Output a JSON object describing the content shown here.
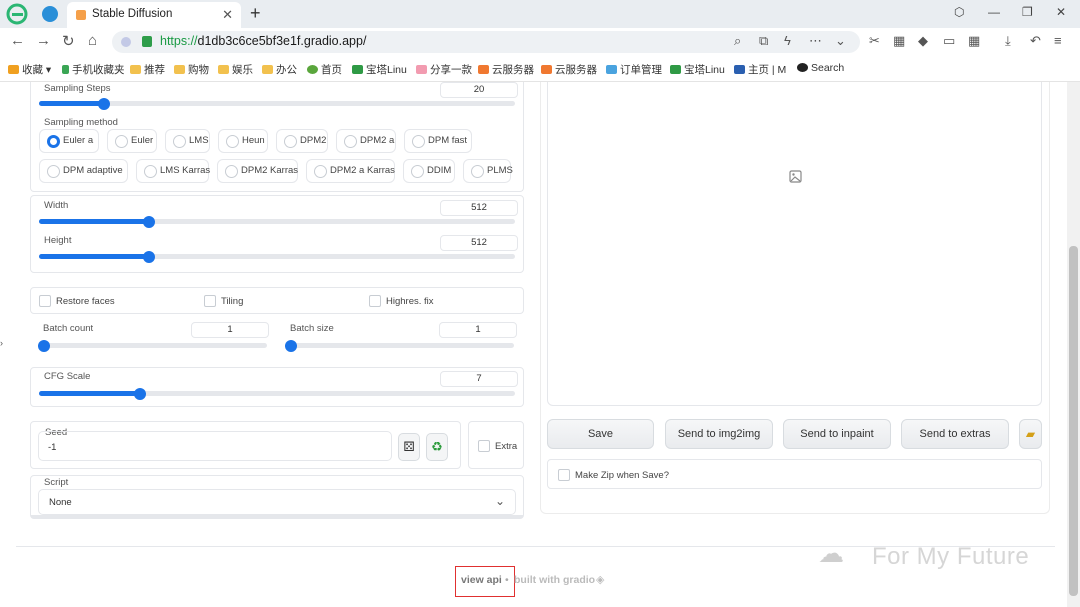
{
  "browser": {
    "tab_title": "Stable Diffusion",
    "url_host": "https://",
    "url_rest": "d1db3c6ce5bf3e1f.gradio.app/"
  },
  "bookmarks": [
    "收藏",
    "手机收藏夹",
    "推荐",
    "购物",
    "娱乐",
    "办公",
    "首页",
    "宝塔Linu",
    "分享一款",
    "云服务器",
    "云服务器",
    "订单管理",
    "宝塔Linu",
    "主页 | M",
    "Search"
  ],
  "settings": {
    "sampling_steps": {
      "label": "Sampling Steps",
      "value": "20",
      "fraction": 0.13
    },
    "sampling_method": {
      "label": "Sampling method",
      "options": [
        "Euler a",
        "Euler",
        "LMS",
        "Heun",
        "DPM2",
        "DPM2 a",
        "DPM fast",
        "DPM adaptive",
        "LMS Karras",
        "DPM2 Karras",
        "DPM2 a Karras",
        "DDIM",
        "PLMS"
      ],
      "selected": "Euler a"
    },
    "width": {
      "label": "Width",
      "value": "512",
      "fraction": 0.23
    },
    "height": {
      "label": "Height",
      "value": "512",
      "fraction": 0.23
    },
    "restore_faces": "Restore faces",
    "tiling": "Tiling",
    "highres_fix": "Highres. fix",
    "batch_count": {
      "label": "Batch count",
      "value": "1",
      "fraction": 0.0
    },
    "batch_size": {
      "label": "Batch size",
      "value": "1",
      "fraction": 0.0
    },
    "cfg_scale": {
      "label": "CFG Scale",
      "value": "7",
      "fraction": 0.21
    },
    "seed": {
      "label": "Seed",
      "value": "-1"
    },
    "extra": "Extra",
    "script": {
      "label": "Script",
      "value": "None"
    }
  },
  "output": {
    "buttons": [
      "Save",
      "Send to img2img",
      "Send to inpaint",
      "Send to extras"
    ],
    "make_zip": "Make Zip when Save?"
  },
  "footer": {
    "view_api": "view api",
    "sep": "•",
    "built_with": "built with gradio"
  },
  "watermark": "For My Future",
  "colors": {
    "accent": "#1a73e8",
    "highlight_box": "#e03030"
  }
}
